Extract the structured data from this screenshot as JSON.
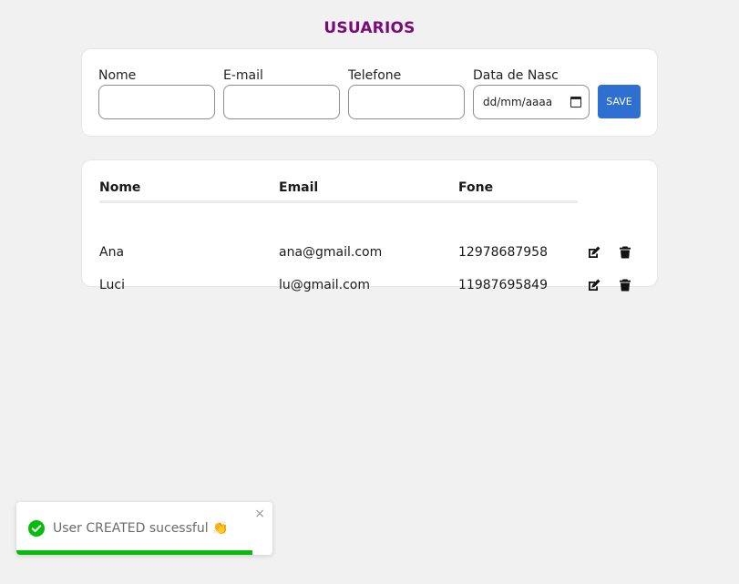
{
  "page": {
    "title": "USUARIOS"
  },
  "form": {
    "fields": [
      {
        "label": "Nome",
        "value": ""
      },
      {
        "label": "E-mail",
        "value": ""
      },
      {
        "label": "Telefone",
        "value": ""
      },
      {
        "label": "Data de Nasc",
        "value": "",
        "placeholder": "dd/mm/aaaa"
      }
    ],
    "save_label": "SAVE"
  },
  "table": {
    "headers": {
      "nome": "Nome",
      "email": "Email",
      "fone": "Fone"
    },
    "rows": [
      {
        "nome": "Ana",
        "email": "ana@gmail.com",
        "fone": "12978687958"
      },
      {
        "nome": "Luci",
        "email": "lu@gmail.com",
        "fone": "11987695849"
      }
    ]
  },
  "toast": {
    "message": "User CREATED sucessful 👏",
    "close_glyph": "×",
    "progress": 0.92,
    "colors": {
      "success": "#07bc0c"
    }
  },
  "colors": {
    "title": "#7a0a7a",
    "save_button": "#2f6fd1",
    "background": "#f1f1f1"
  },
  "icons": {
    "edit": "edit-icon",
    "delete": "trash-icon",
    "calendar": "calendar-icon",
    "success": "check-circle-icon"
  }
}
